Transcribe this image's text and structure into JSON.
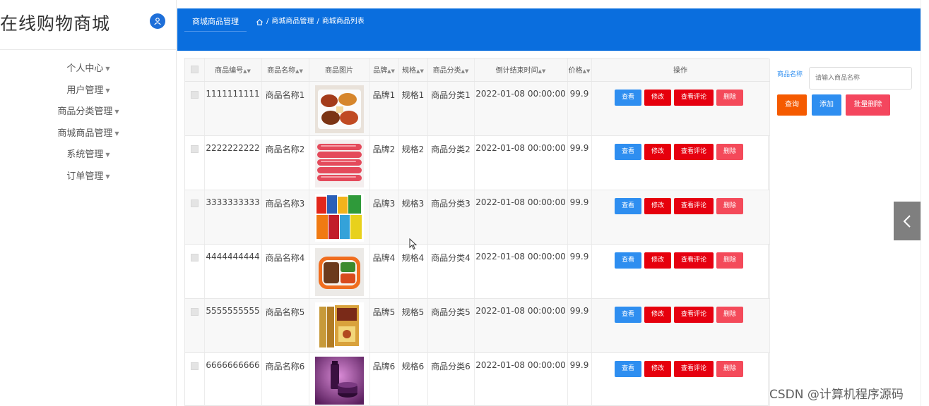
{
  "app": {
    "title": "在线购物商城"
  },
  "sidebar": {
    "items": [
      {
        "label": "个人中心"
      },
      {
        "label": "用户管理"
      },
      {
        "label": "商品分类管理"
      },
      {
        "label": "商城商品管理"
      },
      {
        "label": "系统管理"
      },
      {
        "label": "订单管理"
      }
    ]
  },
  "header": {
    "tab": "商城商品管理",
    "breadcrumb": [
      "商城商品管理",
      "商城商品列表"
    ]
  },
  "table": {
    "columns": [
      "商品编号",
      "商品名称",
      "商品图片",
      "品牌",
      "规格",
      "商品分类",
      "倒计结束时间",
      "价格",
      "操作"
    ],
    "rows": [
      {
        "code": "1111111111",
        "name": "商品名称1",
        "image": "food-tray",
        "brand": "品牌1",
        "spec": "规格1",
        "category": "商品分类1",
        "end_time": "2022-01-08 00:00:00",
        "price": "99.9"
      },
      {
        "code": "2222222222",
        "name": "商品名称2",
        "image": "sausages",
        "brand": "品牌2",
        "spec": "规格2",
        "category": "商品分类2",
        "end_time": "2022-01-08 00:00:00",
        "price": "99.9"
      },
      {
        "code": "3333333333",
        "name": "商品名称3",
        "image": "snack-packs",
        "brand": "品牌3",
        "spec": "规格3",
        "category": "商品分类3",
        "end_time": "2022-01-08 00:00:00",
        "price": "99.9"
      },
      {
        "code": "4444444444",
        "name": "商品名称4",
        "image": "bento-box",
        "brand": "品牌4",
        "spec": "规格4",
        "category": "商品分类4",
        "end_time": "2022-01-08 00:00:00",
        "price": "99.9"
      },
      {
        "code": "5555555555",
        "name": "商品名称5",
        "image": "book-set",
        "brand": "品牌5",
        "spec": "规格5",
        "category": "商品分类5",
        "end_time": "2022-01-08 00:00:00",
        "price": "99.9"
      },
      {
        "code": "6666666666",
        "name": "商品名称6",
        "image": "cosmetics",
        "brand": "品牌6",
        "spec": "规格6",
        "category": "商品分类6",
        "end_time": "2022-01-08 00:00:00",
        "price": "99.9"
      }
    ],
    "actions": {
      "view": "查看",
      "edit": "修改",
      "review": "查看评论",
      "delete": "删除"
    }
  },
  "search": {
    "label": "商品名称",
    "placeholder": "请输入商品名称",
    "query_button": "查询",
    "add_button": "添加",
    "batch_delete_button": "批量删除"
  },
  "watermark": "CSDN @计算机程序源码",
  "colors": {
    "header_blue": "#0a6ede",
    "primary": "#2e8ef0",
    "danger": "#e6000c",
    "orange": "#f55a00",
    "pink": "#f4465e"
  }
}
